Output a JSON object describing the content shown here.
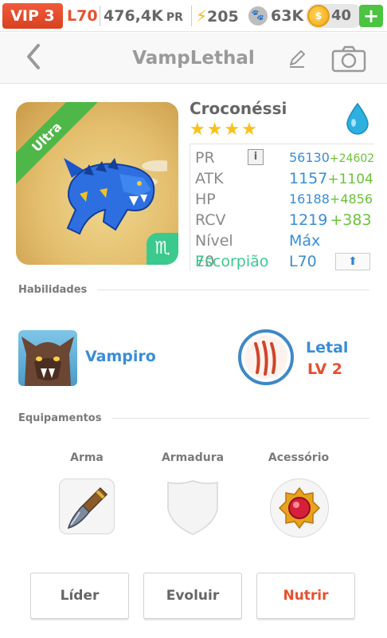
{
  "status_bar": {
    "vip": "VIP 3",
    "level": "L70",
    "pr_value": "476,4K",
    "pr_unit": "PR",
    "energy": "205",
    "paw_count": "63K",
    "coins": "40",
    "add_label": "+",
    "icons": [
      "lightning-icon",
      "paw-icon",
      "coin-icon",
      "plus-icon"
    ]
  },
  "header": {
    "title": "VampLethal",
    "icons": [
      "chevron-left-icon",
      "pencil-icon",
      "camera-icon"
    ]
  },
  "monster": {
    "rarity_ribbon": "Ultra",
    "name": "Croconéssi",
    "stars": "★★★★",
    "element_icon": "water-drop-icon",
    "zodiac_symbol": "♏",
    "stats": [
      {
        "label": "PR",
        "value": "56130",
        "bonus": "+24602"
      },
      {
        "label": "ATK",
        "value": "1157",
        "bonus": "+1104"
      },
      {
        "label": "HP",
        "value": "16188",
        "bonus": "+4856"
      },
      {
        "label": "RCV",
        "value": "1219",
        "bonus": "+383"
      },
      {
        "label": "Nível 70",
        "value": "Máx",
        "bonus": ""
      },
      {
        "label": "Escorpião",
        "value": "L70",
        "bonus": ""
      }
    ],
    "info_label": "i",
    "upgrade_label": "⬆"
  },
  "abilities": {
    "section_title": "Habilidades",
    "skill_name": "Vampiro",
    "trait_name": "Letal",
    "trait_level": "LV 2"
  },
  "equipment": {
    "section_title": "Equipamentos",
    "slots": [
      {
        "label": "Arma",
        "icon": "dagger-icon"
      },
      {
        "label": "Armadura",
        "icon": "shield-icon"
      },
      {
        "label": "Acessório",
        "icon": "amulet-icon"
      }
    ]
  },
  "actions": {
    "leader": "Líder",
    "evolve": "Evoluir",
    "feed": "Nutrir"
  },
  "colors": {
    "accent_orange": "#e8502e",
    "stat_blue": "#3a8dd8",
    "bonus_green": "#6bc23a",
    "zodiac_green": "#3cc98e"
  }
}
